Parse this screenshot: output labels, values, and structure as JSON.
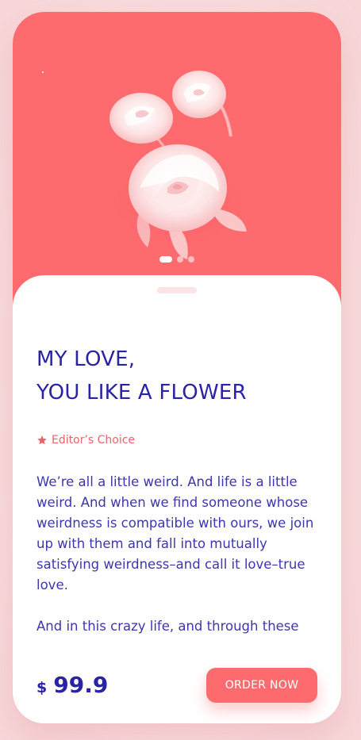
{
  "hero": {
    "image": "rose-bouquet-illustration",
    "pager": {
      "count": 3,
      "active_index": 0
    },
    "background_color": "#fe6b6f"
  },
  "product": {
    "title_line1": "MY LOVE,",
    "title_line2": "YOU LIKE A FLOWER",
    "badge_icon": "star-icon",
    "badge_label": "Editor’s Choice",
    "description_p1": "We’re all a little weird. And life is a little weird. And when we find someone whose weirdness is compatible with ours, we join up with them and fall into mutually satisfying weirdness–and call it love–true love.",
    "description_p2": "And in this crazy life, and through these"
  },
  "purchase": {
    "currency": "$",
    "price": "99.9",
    "order_label": "ORDER NOW"
  },
  "colors": {
    "accent": "#fe6b6f",
    "text_primary": "#2a23a8",
    "text_body": "#3d36b0"
  }
}
